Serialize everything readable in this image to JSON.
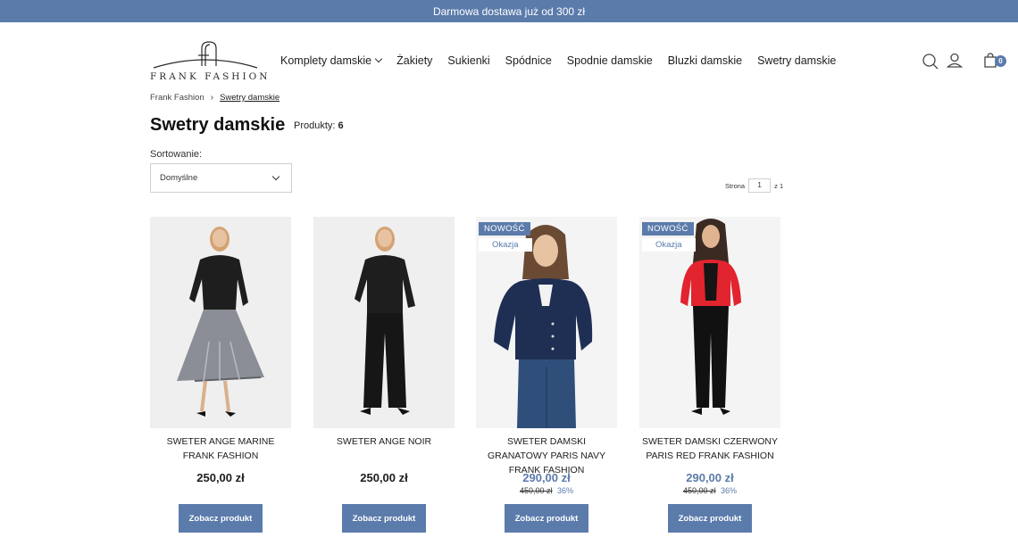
{
  "topbar": {
    "text": "Darmowa dostawa już od 300 zł"
  },
  "logo": {
    "text": "FRANK FASHION"
  },
  "nav": {
    "items": [
      {
        "label": "Komplety damskie"
      },
      {
        "label": "Żakiety"
      },
      {
        "label": "Sukienki"
      },
      {
        "label": "Spódnice"
      },
      {
        "label": "Spodnie damskie"
      },
      {
        "label": "Bluzki damskie"
      },
      {
        "label": "Swetry damskie"
      }
    ]
  },
  "header_icons": {
    "search": "search-icon",
    "account": "user-icon",
    "cart": "bag-icon",
    "cart_count": "0"
  },
  "breadcrumb": {
    "home": "Frank Fashion",
    "current": "Swetry damskie"
  },
  "page": {
    "title": "Swetry damskie",
    "count_label": "Produkty:",
    "count_value": "6"
  },
  "sort": {
    "label": "Sortowanie:",
    "value": "Domyślne"
  },
  "pager": {
    "label": "Strona",
    "value": "1",
    "of": "z 1"
  },
  "colors": {
    "accent": "#5b7bab"
  },
  "products": [
    {
      "name": "SWETER ANGE MARINE FRANK FASHION",
      "price": "250,00 zł",
      "button": "Zobacz produkt"
    },
    {
      "name": "SWETER ANGE NOIR",
      "price": "250,00 zł",
      "button": "Zobacz produkt"
    },
    {
      "name": "SWETER DAMSKI GRANATOWY PARIS NAVY FRANK FASHION",
      "price": "290,00 zł",
      "old_price": "450,00 zł",
      "discount": "36%",
      "badge_new": "NOWOŚĆ",
      "badge_sale": "Okazja",
      "button": "Zobacz produkt"
    },
    {
      "name": "SWETER DAMSKI CZERWONY PARIS RED FRANK FASHION",
      "price": "290,00 zł",
      "old_price": "450,00 zł",
      "discount": "36%",
      "badge_new": "NOWOŚĆ",
      "badge_sale": "Okazja",
      "button": "Zobacz produkt"
    }
  ]
}
